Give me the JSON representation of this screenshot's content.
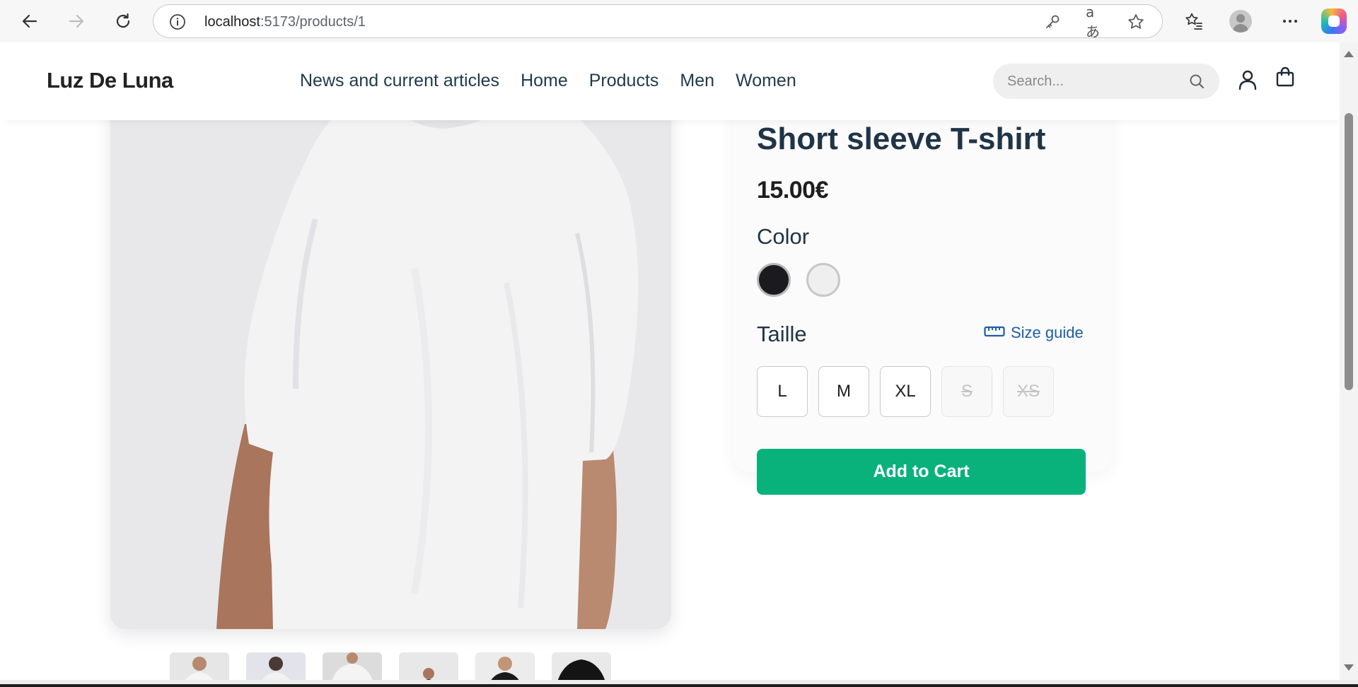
{
  "browser": {
    "url_host": "localhost",
    "url_path": ":5173/products/1"
  },
  "site": {
    "logo": "Luz De Luna",
    "nav": [
      "News and current articles",
      "Home",
      "Products",
      "Men",
      "Women"
    ],
    "search_placeholder": "Search..."
  },
  "product": {
    "title": "Short sleeve T-shirt",
    "price": "15.00€",
    "color_label": "Color",
    "colors": [
      "#1b1b1f",
      "#efefef"
    ],
    "size_label": "Taille",
    "size_guide": "Size guide",
    "sizes": [
      {
        "label": "L",
        "available": true
      },
      {
        "label": "M",
        "available": true
      },
      {
        "label": "XL",
        "available": true
      },
      {
        "label": "S",
        "available": false
      },
      {
        "label": "XS",
        "available": false
      }
    ],
    "add_to_cart": "Add to Cart",
    "accent_color": "#08b27a"
  }
}
